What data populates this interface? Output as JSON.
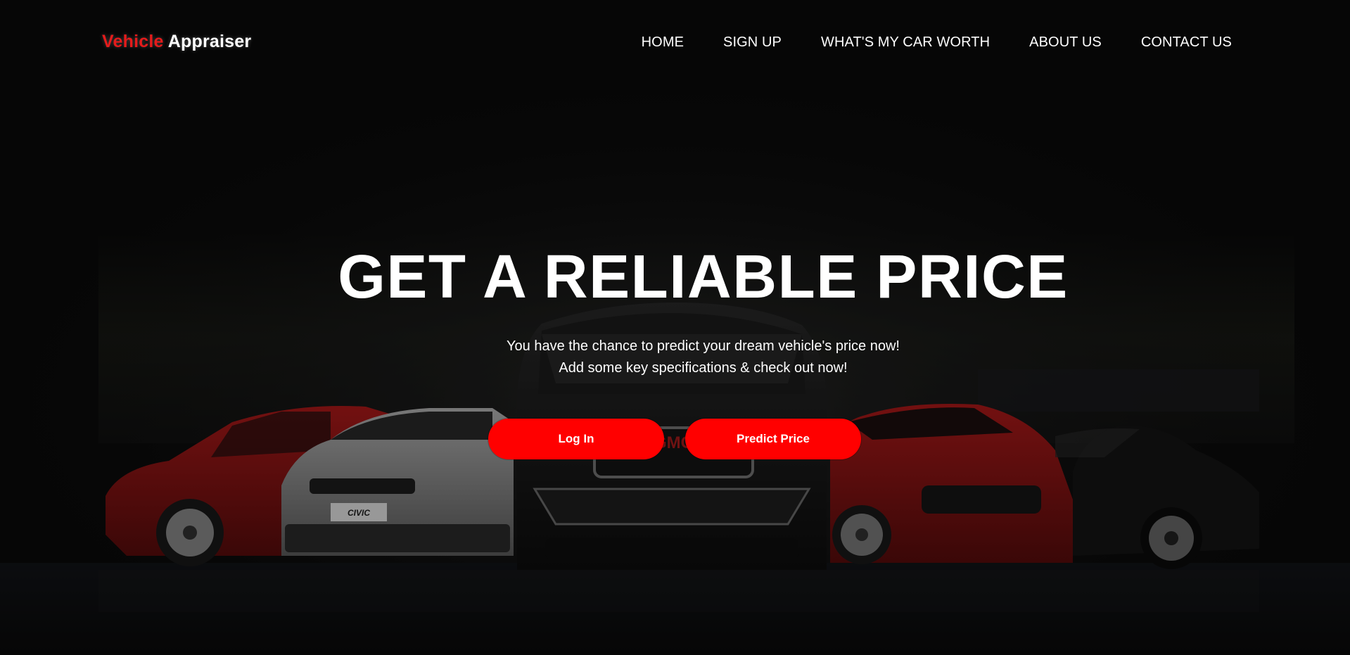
{
  "brand": {
    "part1": "Vehicle",
    "part2": "Appraiser"
  },
  "nav": {
    "items": [
      {
        "label": "HOME"
      },
      {
        "label": "SIGN UP"
      },
      {
        "label": "WHAT'S MY CAR WORTH"
      },
      {
        "label": "ABOUT US"
      },
      {
        "label": "CONTACT US"
      }
    ]
  },
  "hero": {
    "title": "GET A RELIABLE PRICE",
    "subtitle_line1": "You have the chance to predict your dream vehicle's price now!",
    "subtitle_line2": "Add some key specifications & check out now!",
    "login_label": "Log In",
    "predict_label": "Predict Price",
    "grille_text": "GMC",
    "plate_text": "CIVIC"
  },
  "colors": {
    "background": "#0a0a0a",
    "accent": "#ff0000",
    "brand_red": "#e41b1b",
    "text": "#ffffff"
  }
}
